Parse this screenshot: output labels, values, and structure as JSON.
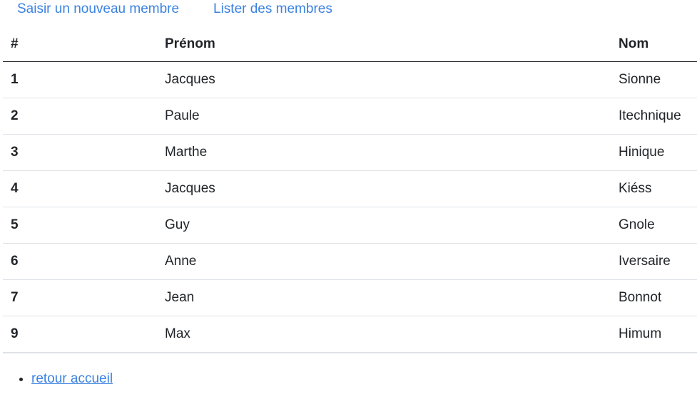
{
  "nav": {
    "new_member": "Saisir un nouveau membre",
    "list_members": "Lister des membres"
  },
  "table": {
    "headers": [
      "#",
      "Prénom",
      "Nom"
    ],
    "rows": [
      {
        "id": "1",
        "prenom": "Jacques",
        "nom": "Sionne"
      },
      {
        "id": "2",
        "prenom": "Paule",
        "nom": "Itechnique"
      },
      {
        "id": "3",
        "prenom": "Marthe",
        "nom": "Hinique"
      },
      {
        "id": "4",
        "prenom": "Jacques",
        "nom": "Kiéss"
      },
      {
        "id": "5",
        "prenom": "Guy",
        "nom": "Gnole"
      },
      {
        "id": "6",
        "prenom": "Anne",
        "nom": "Iversaire"
      },
      {
        "id": "7",
        "prenom": "Jean",
        "nom": "Bonnot"
      },
      {
        "id": "9",
        "prenom": "Max",
        "nom": "Himum"
      }
    ]
  },
  "footer": {
    "home_link": "retour accueil"
  },
  "colors": {
    "link": "#3b82e0",
    "text": "#212529",
    "row_border": "#dee2e6"
  }
}
